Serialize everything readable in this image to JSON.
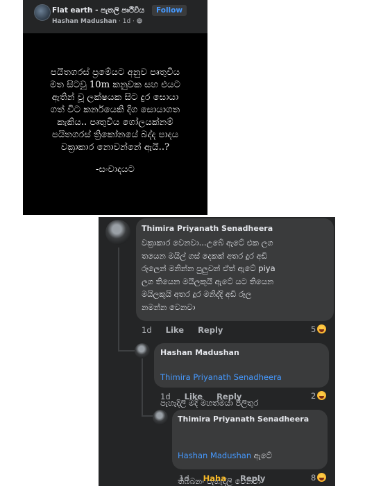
{
  "post": {
    "group_name": "Flat earth - පැතලි පෘථිවිය",
    "follow_label": "Follow",
    "author": "Hashan Madushan",
    "time": "1d",
    "privacy_icon": "globe-icon",
    "body": "පයිතගරස් ප්‍රමේයට අනුව පෘතුවිය\nමත සිටවූ 10m කනුවක සහ එයට\nඇතින් වූ ලක්ෂයක සිට දුර සොයා\nගත් විට කර්නයෙකි දිග සොයාගත\nකැකිය.. පෘතුවිය ගෝලයක්නම්\nපයිතගරස් ත්‍රිකෝනයේ බද්ද පාදය\nවක්‍රාකාර නොවන්නේ ඇයි..?",
    "signature": "-සංවාදයට"
  },
  "comments": [
    {
      "author": "Thimira Priyanath Senadheera",
      "text": "වක්‍රාකාර වෙනවා...උබේ ඇටේ එක ලග\nතයෙන මයිල් ගස් දෙකක් අතර දුර අඩි\nරූලෙන් මනින්න පුලුවන් ඒත් ඇටේ piya\nලග තියෙන මයිලකුයි ඇටේ යට තියෙන\nමයිලකුයි අතර දුර මනිද්දි අඩි රූල\nනමන්න වෙනවා",
      "time": "1d",
      "like": "Like",
      "reply": "Reply",
      "reaction_count": "5"
    },
    {
      "author": "Hashan Madushan",
      "mention": "Thimira Priyanath Senadheera",
      "text": "පැහැදිලි මදි මහත්මයා පිලිතුර",
      "time": "1d",
      "like": "Like",
      "reply": "Reply",
      "reaction_count": "2"
    },
    {
      "author": "Thimira Priyanath Senadheera",
      "mention": "Hashan Madushan",
      "mention_suffix": " ඇටේ",
      "text": "තිබ්බනං පැහැදිලි වෙනවා\nමහත්මයා..ඉස්තුති",
      "time": "1d",
      "like": "Haha",
      "reply": "Reply",
      "reaction_count": "8"
    }
  ],
  "colors": {
    "panel": "#242526",
    "bubble": "#3a3b3c",
    "link": "#4599ff",
    "haha": "#f7b928"
  }
}
